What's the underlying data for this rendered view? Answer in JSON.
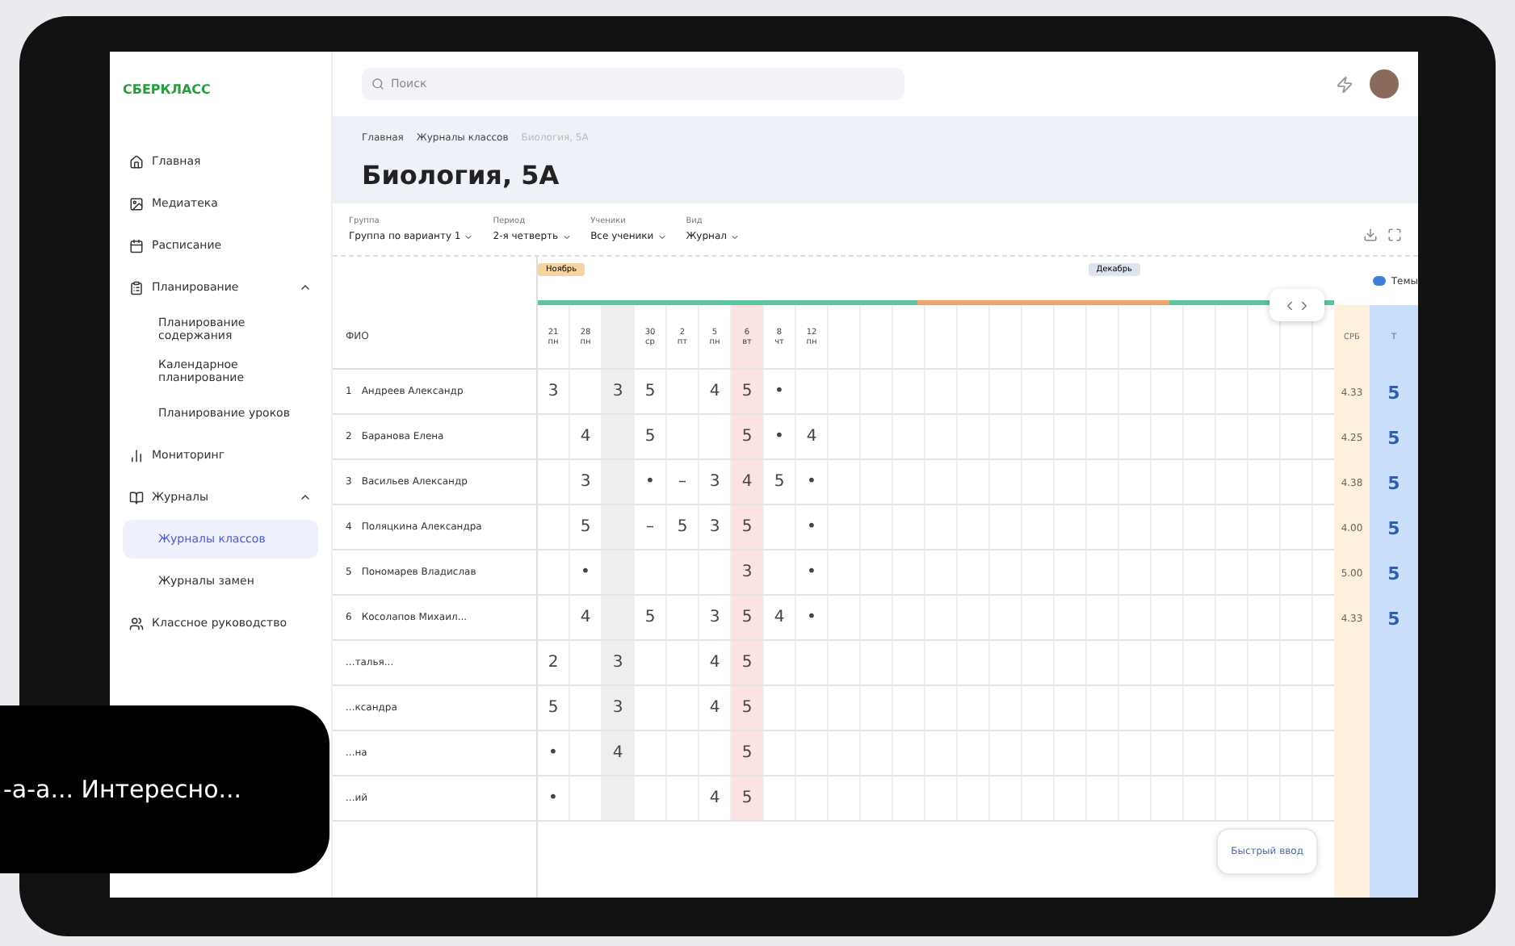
{
  "app": {
    "logo": "СБЕРКЛАСС"
  },
  "sidebar": {
    "items": [
      {
        "label": "Главная",
        "selected": false
      },
      {
        "label": "Медиатека",
        "selected": false
      },
      {
        "label": "Расписание",
        "selected": false
      },
      {
        "label": "Планирование",
        "expanded": true,
        "selected": false,
        "children": [
          {
            "label": "Планирование содержания",
            "selected": false
          },
          {
            "label": "Календарное планирование",
            "selected": false
          },
          {
            "label": "Планирование уроков",
            "selected": false
          }
        ]
      },
      {
        "label": "Мониторинг",
        "selected": false
      },
      {
        "label": "Журналы",
        "expanded": true,
        "selected": false,
        "children": [
          {
            "label": "Журналы классов",
            "selected": true
          },
          {
            "label": "Журналы замен",
            "selected": false
          }
        ]
      },
      {
        "label": "Классное руководство",
        "selected": false
      }
    ]
  },
  "search": {
    "placeholder": "Поиск"
  },
  "breadcrumbs": [
    "Главная",
    "Журналы классов",
    "Биология, 5А"
  ],
  "title": "Биология, 5А",
  "filters": [
    {
      "label": "Группа",
      "value": "Группа по варианту 1"
    },
    {
      "label": "Период",
      "value": "2-я четверть"
    },
    {
      "label": "Ученики",
      "value": "Все ученики"
    },
    {
      "label": "Вид",
      "value": "Журнал"
    }
  ],
  "journal": {
    "months": [
      {
        "label": "Ноябрь",
        "color": "#f7d3a0"
      },
      {
        "label": "Декабрь",
        "color": "#dfe5ef"
      }
    ],
    "topics_toggle": {
      "label": "Темы",
      "on": true
    },
    "name_header": "ФИО",
    "avg_header": "СРБ",
    "final_header": "Т",
    "dates": [
      {
        "day": "21",
        "weekday": "пн",
        "highlighted": false,
        "shaded": false
      },
      {
        "day": "28",
        "weekday": "пн",
        "highlighted": false,
        "shaded": false
      },
      {
        "highlighted": false,
        "shaded": true
      },
      {
        "day": "30",
        "weekday": "ср",
        "highlighted": false,
        "shaded": false
      },
      {
        "day": "2",
        "weekday": "пт",
        "highlighted": false,
        "shaded": false
      },
      {
        "day": "5",
        "weekday": "пн",
        "highlighted": false,
        "shaded": false
      },
      {
        "day": "6",
        "weekday": "вт",
        "highlighted": true,
        "shaded": false
      },
      {
        "day": "8",
        "weekday": "чт",
        "highlighted": false,
        "shaded": false
      },
      {
        "day": "12",
        "weekday": "пн",
        "highlighted": false,
        "shaded": false
      }
    ],
    "rows": [
      {
        "number": "1",
        "name": "Андреев Александр",
        "cells": [
          {
            "kind": "grade",
            "value": "3"
          },
          {
            "kind": "blank"
          },
          {
            "kind": "grade",
            "value": "3"
          },
          {
            "kind": "grade",
            "value": "5"
          },
          {
            "kind": "blank"
          },
          {
            "kind": "grade",
            "value": "4"
          },
          {
            "kind": "grade",
            "value": "5"
          },
          {
            "kind": "grade",
            "value": "•"
          },
          {
            "kind": "blank"
          }
        ],
        "average": "4.33",
        "final": "5"
      },
      {
        "number": "2",
        "name": "Баранова Елена",
        "cells": [
          {
            "kind": "blank"
          },
          {
            "kind": "grade",
            "value": "4"
          },
          {
            "kind": "blank"
          },
          {
            "kind": "grade",
            "value": "5"
          },
          {
            "kind": "blank"
          },
          {
            "kind": "blank"
          },
          {
            "kind": "grade",
            "value": "5"
          },
          {
            "kind": "grade",
            "value": "•"
          },
          {
            "kind": "grade",
            "value": "4"
          }
        ],
        "average": "4.25",
        "final": "5"
      },
      {
        "number": "3",
        "name": "Васильев Александр",
        "cells": [
          {
            "kind": "blank"
          },
          {
            "kind": "grade",
            "value": "3"
          },
          {
            "kind": "blank"
          },
          {
            "kind": "grade",
            "value": "•"
          },
          {
            "kind": "grade",
            "value": "–"
          },
          {
            "kind": "grade",
            "value": "3"
          },
          {
            "kind": "grade",
            "value": "4"
          },
          {
            "kind": "grade",
            "value": "5"
          },
          {
            "kind": "grade",
            "value": "•"
          }
        ],
        "average": "4.38",
        "final": "5"
      },
      {
        "number": "4",
        "name": "Поляцкина Александра",
        "cells": [
          {
            "kind": "blank"
          },
          {
            "kind": "grade",
            "value": "5"
          },
          {
            "kind": "blank"
          },
          {
            "kind": "grade",
            "value": "–"
          },
          {
            "kind": "grade",
            "value": "5"
          },
          {
            "kind": "grade",
            "value": "3"
          },
          {
            "kind": "grade",
            "value": "5"
          },
          {
            "kind": "blank"
          },
          {
            "kind": "grade",
            "value": "•"
          }
        ],
        "average": "4.00",
        "final": "5"
      },
      {
        "number": "5",
        "name": "Пономарев Владислав",
        "cells": [
          {
            "kind": "blank"
          },
          {
            "kind": "grade",
            "value": "•"
          },
          {
            "kind": "blank"
          },
          {
            "kind": "blank"
          },
          {
            "kind": "blank"
          },
          {
            "kind": "blank"
          },
          {
            "kind": "grade",
            "value": "3"
          },
          {
            "kind": "blank"
          },
          {
            "kind": "grade",
            "value": "•"
          }
        ],
        "average": "5.00",
        "final": "5"
      },
      {
        "number": "6",
        "name": "Косолапов Михаил...",
        "cells": [
          {
            "kind": "blank"
          },
          {
            "kind": "grade",
            "value": "4"
          },
          {
            "kind": "blank"
          },
          {
            "kind": "grade",
            "value": "5"
          },
          {
            "kind": "blank"
          },
          {
            "kind": "grade",
            "value": "3"
          },
          {
            "kind": "grade",
            "value": "5"
          },
          {
            "kind": "grade",
            "value": "4"
          },
          {
            "kind": "grade",
            "value": "•"
          }
        ],
        "average": "4.33",
        "final": "5"
      },
      {
        "name": "...талья...",
        "cells": [
          {
            "kind": "grade",
            "value": "2"
          },
          {
            "kind": "blank"
          },
          {
            "kind": "grade",
            "value": "3"
          },
          {
            "kind": "blank"
          },
          {
            "kind": "blank"
          },
          {
            "kind": "grade",
            "value": "4"
          },
          {
            "kind": "grade",
            "value": "5"
          }
        ]
      },
      {
        "name": "...ксандра",
        "cells": [
          {
            "kind": "grade",
            "value": "5"
          },
          {
            "kind": "blank"
          },
          {
            "kind": "grade",
            "value": "3"
          },
          {
            "kind": "blank"
          },
          {
            "kind": "blank"
          },
          {
            "kind": "grade",
            "value": "4"
          },
          {
            "kind": "grade",
            "value": "5"
          }
        ]
      },
      {
        "name": "...на",
        "cells": [
          {
            "kind": "grade",
            "value": "•"
          },
          {
            "kind": "blank"
          },
          {
            "kind": "grade",
            "value": "4"
          },
          {
            "kind": "blank"
          },
          {
            "kind": "blank"
          },
          {
            "kind": "blank"
          },
          {
            "kind": "grade",
            "value": "5"
          }
        ]
      },
      {
        "name": "...ий",
        "cells": [
          {
            "kind": "grade",
            "value": "•"
          },
          {
            "kind": "blank"
          },
          {
            "kind": "blank"
          },
          {
            "kind": "blank"
          },
          {
            "kind": "blank"
          },
          {
            "kind": "grade",
            "value": "4"
          },
          {
            "kind": "grade",
            "value": "5"
          }
        ]
      }
    ]
  },
  "quick_input": "Быстрый ввод",
  "caption": "-а-а... Интересно..."
}
